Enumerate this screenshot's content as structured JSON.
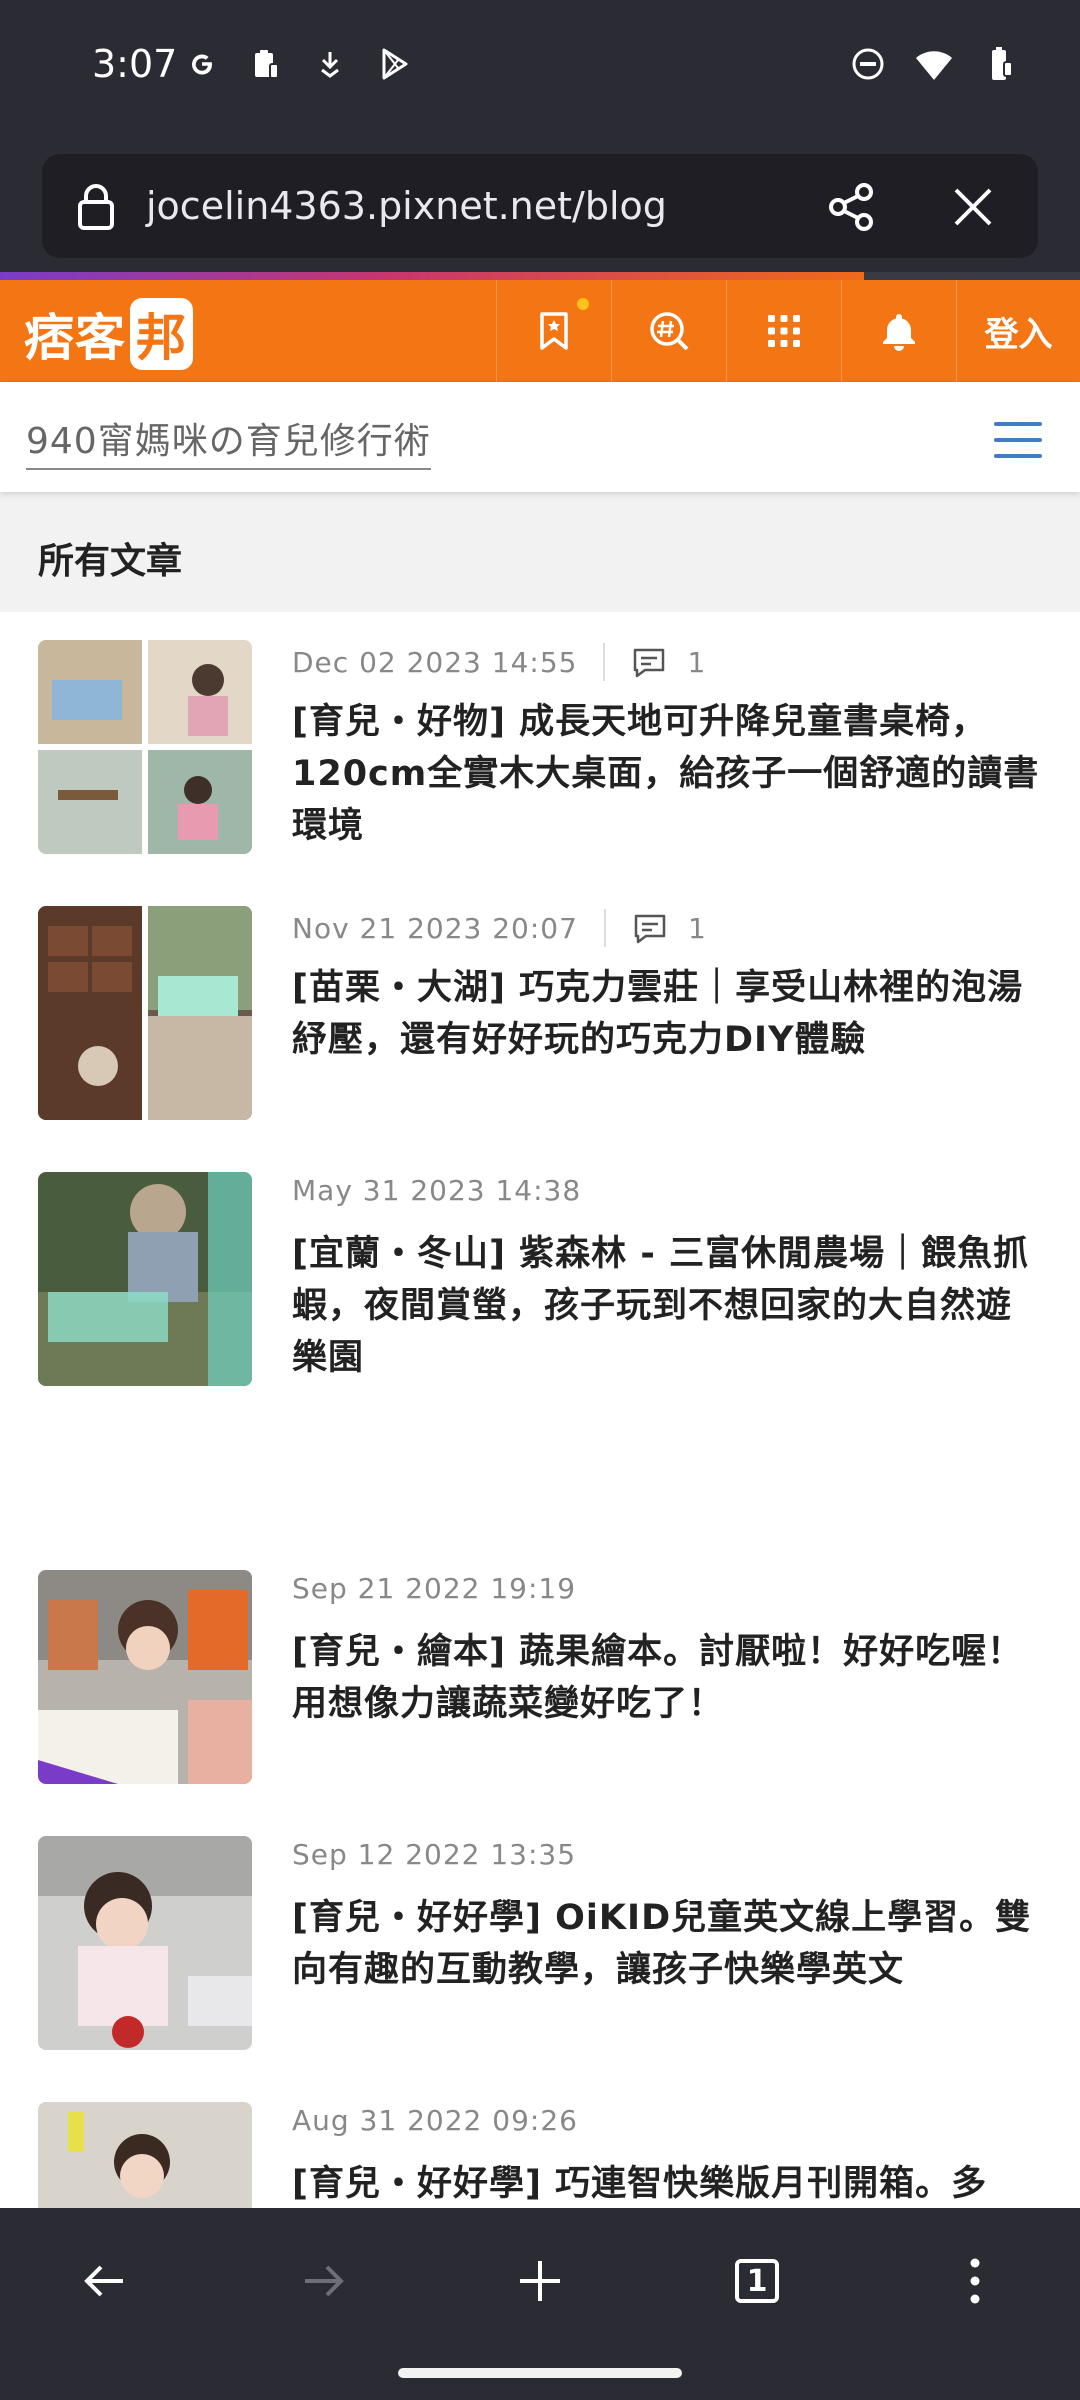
{
  "status_bar": {
    "time": "3:07",
    "left_icons": [
      "google-icon",
      "clipboard-icon",
      "download-icon",
      "play-store-icon"
    ],
    "right_icons": [
      "dnd-icon",
      "wifi-icon",
      "battery-icon"
    ]
  },
  "browser": {
    "url": "jocelin4363.pixnet.net/blog",
    "load_progress": 0.8,
    "tab_count": "1"
  },
  "site_header": {
    "logo_text": "痞客",
    "logo_badge": "邦",
    "login_label": "登入",
    "brand_color": "#f47514"
  },
  "blog": {
    "title": "940甯媽咪の育兒修行術"
  },
  "section": {
    "title": "所有文章"
  },
  "articles": [
    {
      "date": "Dec 02 2023 14:55",
      "comments": "1",
      "title": "[育兒・好物] 成長天地可升降兒童書桌椅，120cm全實木大桌面，給孩子一個舒適的讀書環境"
    },
    {
      "date": "Nov 21 2023 20:07",
      "comments": "1",
      "title": "[苗栗・大湖] 巧克力雲莊｜享受山林裡的泡湯紓壓，還有好好玩的巧克力DIY體驗"
    },
    {
      "date": "May 31 2023 14:38",
      "title": "[宜蘭・冬山] 紫森林 - 三富休閒農場｜餵魚抓蝦，夜間賞螢，孩子玩到不想回家的大自然遊樂園"
    },
    {
      "date": "Sep 21 2022 19:19",
      "title": "[育兒・繪本] 蔬果繪本。討厭啦！好好吃喔！用想像力讓蔬菜變好吃了！"
    },
    {
      "date": "Sep 12 2022 13:35",
      "title": "[育兒・好好學] OiKID兒童英文線上學習。雙向有趣的互動教學，讓孩子快樂學英文"
    },
    {
      "date": "Aug 31 2022 09:26",
      "title": "[育兒・好好學] 巧連智快樂版月刊開箱。多"
    }
  ]
}
